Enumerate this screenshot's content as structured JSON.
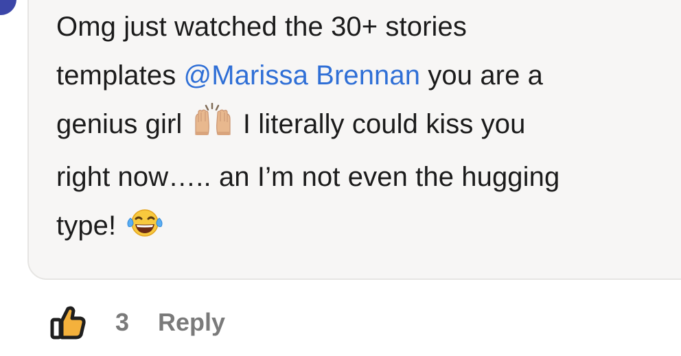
{
  "comment": {
    "line1": "Omg just watched the 30+ stories",
    "line2_pre": "templates ",
    "mention": "@Marissa Brennan",
    "line2_post": " you are a",
    "line3_pre": "genius girl ",
    "emoji1": "raising-hands-emoji",
    "line3_post": " I literally could kiss you",
    "line4": "right now….. an I’m not even the hugging",
    "line5": "type! ",
    "emoji2": "tears-of-joy-emoji"
  },
  "actions": {
    "like_icon": "thumbs-up-icon",
    "like_count": "3",
    "reply_label": "Reply"
  },
  "colors": {
    "mention": "#2f6fd6",
    "bubble": "#f7f6f5",
    "action_text": "#7a7a7a",
    "avatar": "#3b46a8"
  }
}
